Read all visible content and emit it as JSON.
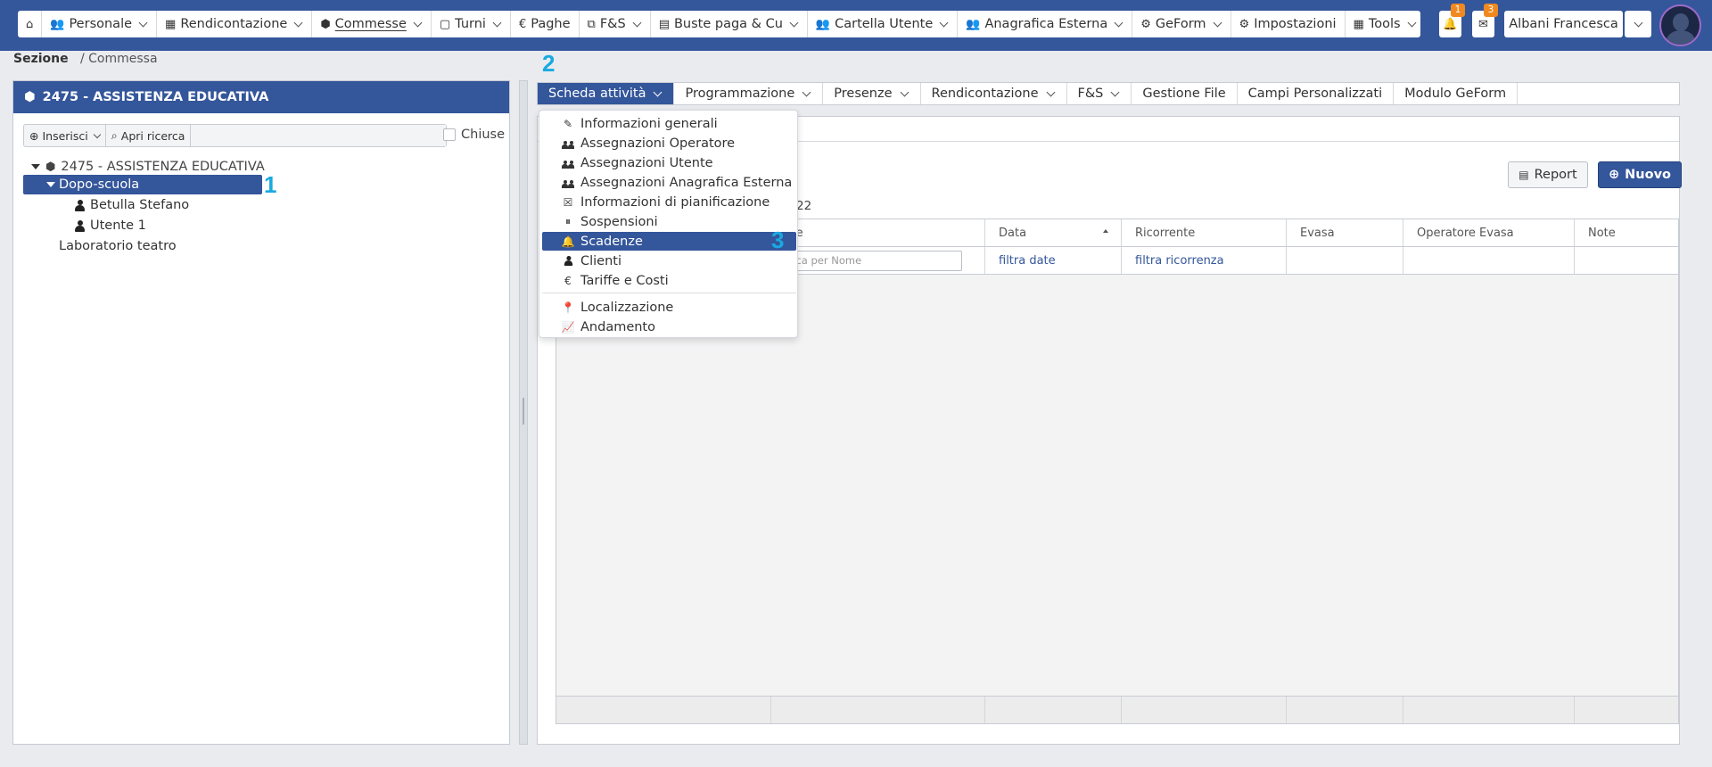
{
  "nav": {
    "items": [
      {
        "label": "",
        "icon": "home-icon",
        "glyph": "⌂",
        "dropdown": false
      },
      {
        "label": "Personale",
        "icon": "users-icon",
        "glyph": "👥",
        "dropdown": true
      },
      {
        "label": "Rendicontazione",
        "icon": "calendar-icon",
        "glyph": "▦",
        "dropdown": true
      },
      {
        "label": "Commesse",
        "icon": "cube-icon",
        "glyph": "⬢",
        "dropdown": true,
        "active": true
      },
      {
        "label": "Turni",
        "icon": "calendar-icon",
        "glyph": "▢",
        "dropdown": true
      },
      {
        "label": "Paghe",
        "icon": "euro-icon",
        "glyph": "€",
        "dropdown": false
      },
      {
        "label": "F&S",
        "icon": "boxes-icon",
        "glyph": "⧉",
        "dropdown": true
      },
      {
        "label": "Buste paga & Cu",
        "icon": "file-pdf-icon",
        "glyph": "▤",
        "dropdown": true
      },
      {
        "label": "Cartella Utente",
        "icon": "users-icon",
        "glyph": "👥",
        "dropdown": true
      },
      {
        "label": "Anagrafica Esterna",
        "icon": "users-icon",
        "glyph": "👥",
        "dropdown": true
      },
      {
        "label": "GeForm",
        "icon": "cogs-icon",
        "glyph": "⚙",
        "dropdown": true
      },
      {
        "label": "Impostazioni",
        "icon": "cogs-icon",
        "glyph": "⚙",
        "dropdown": false
      },
      {
        "label": "Tools",
        "icon": "grid-icon",
        "glyph": "▦",
        "dropdown": true
      }
    ],
    "notifications_count": "1",
    "messages_count": "3",
    "user_name": "Albani Francesca"
  },
  "breadcrumb": {
    "section": "Sezione",
    "current": "/ Commessa"
  },
  "left_panel": {
    "title": "2475 - ASSISTENZA EDUCATIVA",
    "insert_label": "Inserisci",
    "search_label": "Apri ricerca",
    "closed_label": "Chiuse",
    "tree": [
      {
        "label": "2475 - ASSISTENZA EDUCATIVA",
        "kind": "root",
        "expanded": true
      },
      {
        "label": "Dopo-scuola",
        "kind": "group",
        "expanded": true,
        "selected": true
      },
      {
        "label": "Betulla Stefano",
        "kind": "person"
      },
      {
        "label": "Utente 1",
        "kind": "person"
      },
      {
        "label": "Laboratorio teatro",
        "kind": "group"
      }
    ]
  },
  "steps": [
    "1",
    "2",
    "3"
  ],
  "tabs": [
    {
      "label": "Scheda attività",
      "dropdown": true,
      "active": true
    },
    {
      "label": "Programmazione",
      "dropdown": true
    },
    {
      "label": "Presenze",
      "dropdown": true
    },
    {
      "label": "Rendicontazione",
      "dropdown": true
    },
    {
      "label": "F&S",
      "dropdown": true
    },
    {
      "label": "Gestione File",
      "dropdown": false
    },
    {
      "label": "Campi Personalizzati",
      "dropdown": false
    },
    {
      "label": "Modulo GeForm",
      "dropdown": false
    }
  ],
  "menu": [
    {
      "label": "Informazioni generali",
      "icon": "pencil-icon",
      "glyph": "✎"
    },
    {
      "label": "Assegnazioni Operatore",
      "icon": "users-icon",
      "glyph": "people"
    },
    {
      "label": "Assegnazioni Utente",
      "icon": "users-icon",
      "glyph": "people"
    },
    {
      "label": "Assegnazioni Anagrafica Esterna",
      "icon": "users-icon",
      "glyph": "people"
    },
    {
      "label": "Informazioni di pianificazione",
      "icon": "calendar-x-icon",
      "glyph": "☒"
    },
    {
      "label": "Sospensioni",
      "icon": "pause-circle-icon",
      "glyph": "⏸"
    },
    {
      "label": "Scadenze",
      "icon": "bell-icon",
      "glyph": "🔔",
      "active": true
    },
    {
      "label": "Clienti",
      "icon": "user-icon",
      "glyph": "person"
    },
    {
      "label": "Tariffe e Costi",
      "icon": "euro-icon",
      "glyph": "€"
    },
    {
      "label": "Localizzazione",
      "icon": "map-marker-icon",
      "glyph": "📍",
      "after_separator": true
    },
    {
      "label": "Andamento",
      "icon": "line-chart-icon",
      "glyph": "📈"
    }
  ],
  "content": {
    "report_label": "Report",
    "new_label": "Nuovo",
    "count_fragment": "22",
    "columns": [
      {
        "label": "",
        "filter": ""
      },
      {
        "label": "me",
        "filter": "rca per Nome",
        "filter_kind": "input"
      },
      {
        "label": "Data",
        "filter": "filtra date",
        "sorted": "asc"
      },
      {
        "label": "Ricorrente",
        "filter": "filtra ricorrenza"
      },
      {
        "label": "Evasa",
        "filter": ""
      },
      {
        "label": "Operatore Evasa",
        "filter": ""
      },
      {
        "label": "Note",
        "filter": ""
      }
    ]
  },
  "colors": {
    "primary": "#34569a",
    "badge": "#f0891f",
    "step": "#19a9e1"
  }
}
